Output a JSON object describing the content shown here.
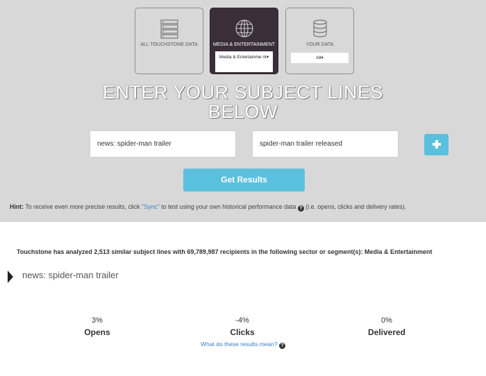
{
  "cards": [
    {
      "label": "ALL TOUCHSTONE DATA",
      "icon": "server-stack-icon"
    },
    {
      "label": "MEDIA & ENTERTAINMENT",
      "icon": "globe-icon",
      "select": "Media & Entertainme nt▾"
    },
    {
      "label": "YOUR DATA",
      "icon": "database-icon",
      "select": "All▾"
    }
  ],
  "headline": {
    "line1": "ENTER YOUR SUBJECT LINES",
    "line2": "BELOW"
  },
  "inputs": [
    "news: spider-man trailer",
    "spider-man trailer released"
  ],
  "get_results": "Get Results",
  "hint": {
    "prefix": "Hint:",
    "text1": " To receive even more precise results, click ",
    "sync": "\"Sync\"",
    "text2": " to test using your own historical performance data ",
    "text3": " (i.e. opens, clicks and delivery rates)."
  },
  "analysis": "Touchstone has analyzed 2,513 similar subject lines with 69,789,987 recipients in the following sector or segment(s): Media & Entertainment",
  "subject": "news: spider-man trailer",
  "metrics": [
    {
      "value": "3%",
      "name": "Opens"
    },
    {
      "value": "-4%",
      "name": "Clicks"
    },
    {
      "value": "0%",
      "name": "Delivered"
    }
  ],
  "meaning_link": "What do these results mean?",
  "colors": {
    "accent": "#5bc0de",
    "active_card": "#3a2f39",
    "background_top": "#d8d8d8"
  }
}
